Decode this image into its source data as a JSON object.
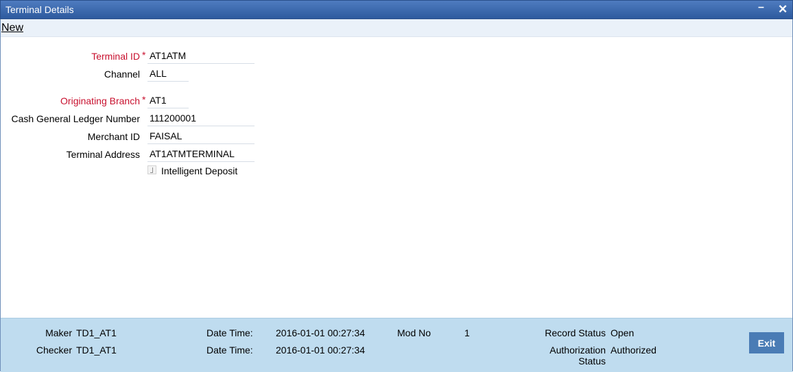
{
  "window": {
    "title": "Terminal Details",
    "minimize_glyph": "–",
    "close_glyph": "✕"
  },
  "toolbar": {
    "new_label": "New"
  },
  "form": {
    "terminal_id": {
      "label": "Terminal ID",
      "required_marker": "*",
      "value": "AT1ATM"
    },
    "channel": {
      "label": "Channel",
      "value": "ALL"
    },
    "originating_branch": {
      "label": "Originating Branch",
      "required_marker": "*",
      "value": "AT1"
    },
    "cash_gl_number": {
      "label": "Cash General Ledger Number",
      "value": "111200001"
    },
    "merchant_id": {
      "label": "Merchant ID",
      "value": "FAISAL"
    },
    "terminal_address": {
      "label": "Terminal Address",
      "value": "AT1ATMTERMINAL"
    },
    "intelligent_deposit": {
      "label": "Intelligent Deposit",
      "checked": false
    }
  },
  "footer": {
    "maker_label": "Maker",
    "maker_value": "TD1_AT1",
    "checker_label": "Checker",
    "checker_value": "TD1_AT1",
    "maker_datetime_label": "Date Time:",
    "maker_datetime_value": "2016-01-01 00:27:34",
    "checker_datetime_label": "Date Time:",
    "checker_datetime_value": "2016-01-01 00:27:34",
    "mod_no_label": "Mod No",
    "mod_no_value": "1",
    "record_status_label": "Record Status",
    "record_status_value": "Open",
    "auth_status_label_line1": "Authorization",
    "auth_status_label_line2": "Status",
    "auth_status_value": "Authorized",
    "exit_label": "Exit"
  },
  "colors": {
    "titlebar": "#2d5a9e",
    "required_label": "#c8102e",
    "footer_bg": "#bfdcef",
    "exit_button": "#4a7cb5"
  }
}
